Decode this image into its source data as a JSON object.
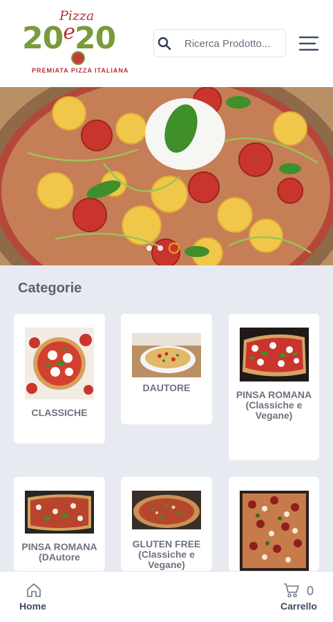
{
  "brand": {
    "logo_top": "Pizza",
    "logo_left": "20",
    "logo_e": "e",
    "logo_right": "20",
    "logo_tagline": "PREMIATA PIZZA ITALIANA"
  },
  "search": {
    "placeholder": "Ricerca Prodotto..."
  },
  "banner": {
    "slides_total": 3,
    "active_slide": 3
  },
  "categories": {
    "title": "Categorie",
    "items": [
      {
        "name": "CLASSICHE"
      },
      {
        "name": "DAUTORE"
      },
      {
        "name": "PINSA ROMANA (Classiche e Vegane)"
      },
      {
        "name": "PINSA ROMANA (DAutore"
      },
      {
        "name": "GLUTEN FREE (Classiche e Vegane)"
      },
      {
        "name": ""
      }
    ]
  },
  "tabbar": {
    "home_label": "Home",
    "cart_label": "Carrello",
    "cart_count": "0"
  },
  "colors": {
    "brand_green": "#7b9a3a",
    "brand_red": "#b5303a",
    "accent_orange": "#f5a623",
    "text_dark": "#3f4a63"
  }
}
